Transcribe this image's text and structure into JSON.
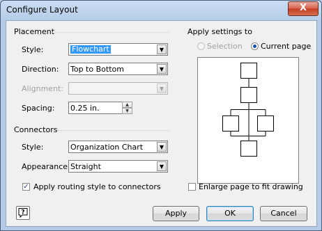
{
  "window": {
    "title": "Configure Layout",
    "close_symbol": "X"
  },
  "placement": {
    "section_label": "Placement",
    "style": {
      "label": "Style:",
      "value": "Flowchart"
    },
    "direction": {
      "label": "Direction:",
      "value": "Top to Bottom"
    },
    "alignment": {
      "label": "Alignment:",
      "value": ""
    },
    "spacing": {
      "label": "Spacing:",
      "value": "0.25 in."
    }
  },
  "connectors": {
    "section_label": "Connectors",
    "style": {
      "label": "Style:",
      "value": "Organization Chart"
    },
    "appearance": {
      "label": "Appearance:",
      "value": "Straight"
    },
    "routing_checkbox": {
      "label": "Apply routing style to connectors",
      "checked": true
    }
  },
  "apply_settings": {
    "section_label": "Apply settings to",
    "selection": {
      "label": "Selection",
      "selected": false,
      "enabled": false
    },
    "current_page": {
      "label": "Current page",
      "selected": true,
      "enabled": true
    }
  },
  "enlarge_checkbox": {
    "label": "Enlarge page to fit drawing",
    "checked": false
  },
  "buttons": {
    "help_glyph": "?",
    "apply": "Apply",
    "ok": "OK",
    "cancel": "Cancel"
  },
  "icons": {
    "dropdown": "dropdown-arrow-icon",
    "spin_up": "spin-up-icon",
    "spin_down": "spin-down-icon",
    "help": "help-icon"
  },
  "colors": {
    "selection_highlight": "#3399ff",
    "titlebar": "#c9dcf2",
    "close_button": "#c23b23"
  }
}
